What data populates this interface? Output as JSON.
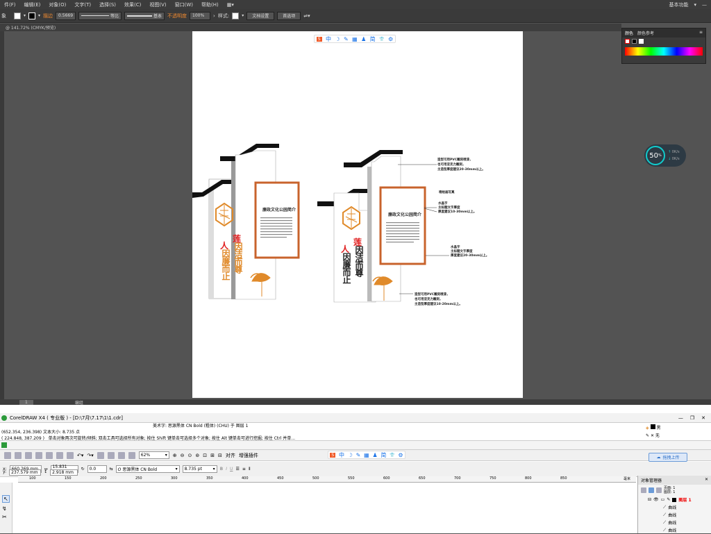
{
  "ai": {
    "menu": [
      "件(F)",
      "编辑(E)",
      "对象(O)",
      "文字(T)",
      "选择(S)",
      "效果(C)",
      "视图(V)",
      "窗口(W)",
      "帮助(H)"
    ],
    "workspace": "基本功能",
    "ctrl": {
      "left_label": "象",
      "stroke_label": "描边",
      "stroke_value": "0.5669",
      "profile_label": "等比",
      "brush_label": "基本",
      "opacity_label": "不透明度",
      "opacity_value": "100%",
      "style_label": "样式:",
      "doc_setup": "文档设置",
      "prefs": "首选项"
    },
    "tab": "@ 141.72% (CMYK/预览)",
    "scroll_zoom": "1",
    "scroll_label": "编组",
    "color_panel": {
      "tab1": "颜色",
      "tab2": "颜色参考"
    },
    "speed": {
      "value": "50",
      "unit": "%",
      "up": "0K/s",
      "down": "0K/s"
    }
  },
  "sticker_icons": [
    "S",
    "中",
    "☽",
    "✎",
    "▦",
    "♟",
    "简",
    "👕",
    "⚙"
  ],
  "design": {
    "left": {
      "panel_title": "廉政文化公园简介",
      "slogan_red_1": "莲",
      "slogan_black_1": "因洁而尊",
      "slogan_red_2": "人",
      "slogan_black_2": "因廉而止"
    },
    "right": {
      "panel_title": "廉政文化公园简介",
      "slogan_red_1": "莲",
      "slogan_black_1": "因洁而尊",
      "slogan_red_2": "人",
      "slogan_black_2": "因廉而止",
      "ann1": [
        "造型可用PVC雕刻喷漆，",
        "也可用亚克力雕刻，",
        "主造型厚度建议20-30mm以上。"
      ],
      "ann2": "喷绘画写真",
      "ann3": [
        "水晶字",
        "主标题文字厚度",
        "厚度建议10-30mm以上。"
      ],
      "ann4": [
        "水晶字",
        "主标题文字厚度",
        "厚度建议20-30mm以上。"
      ],
      "ann5": [
        "造型可用PVC雕刻喷漆，",
        "也可用亚克力雕刻，",
        "主造型厚度建议10-20mm以上。"
      ]
    }
  },
  "cdr": {
    "title": "CorelDRAW X4 ( 专业版 ) - [D:\\7月\\7.17\\1\\1.cdr]",
    "art_text": "美术字: 思源黑体 CN Bold (粗体) (CHU) 于 图层 1",
    "coords1": "(652.354, 236.398)",
    "size_text": "文本大小: 8.735 点",
    "coords2": "( 224.848, 387.209 )",
    "hint": "单击对象两次可旋转/倾斜; 双击工具可选择所有对象; 按住 Shift 键单击可选择多个对象; 按住 Alt 键单击可进行挖掘; 按住 Ctrl 并单...",
    "fill_label": "黑",
    "outline_label": "无",
    "zoom": "62%",
    "snap": "对齐",
    "snap2": "增强插件",
    "x": "660.269 mm",
    "y": "237.579 mm",
    "w": "15.831 mm",
    "h": "2.918 mm",
    "angle": "0.0",
    "font": "思源黑体 CN Bold",
    "font_size": "8.735 pt",
    "upload": "拖拽上传",
    "ruler": [
      "100",
      "150",
      "200",
      "250",
      "300",
      "350",
      "400",
      "450",
      "500",
      "550",
      "600",
      "650",
      "700",
      "750",
      "800",
      "850",
      "毫米"
    ],
    "obj_mgr": {
      "title": "对象管理器",
      "page": "页面: 1",
      "layer": "图层: 1",
      "layer_item": "图层 1",
      "items": [
        "曲线",
        "曲线",
        "曲线",
        "曲线"
      ]
    }
  }
}
